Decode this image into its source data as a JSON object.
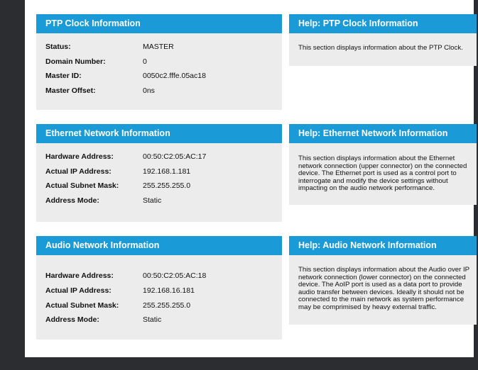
{
  "ptp": {
    "title": "PTP Clock Information",
    "rows": [
      {
        "label": "Status:",
        "value": "MASTER"
      },
      {
        "label": "Domain Number:",
        "value": "0"
      },
      {
        "label": "Master ID:",
        "value": "0050c2.fffe.05ac18"
      },
      {
        "label": "Master Offset:",
        "value": "0ns"
      }
    ],
    "help_title": "Help: PTP Clock Information",
    "help_text": "This section displays information about the PTP Clock."
  },
  "ethernet": {
    "title": "Ethernet Network Information",
    "rows": [
      {
        "label": "Hardware Address:",
        "value": "00:50:C2:05:AC:17"
      },
      {
        "label": "Actual IP Address:",
        "value": "192.168.1.181"
      },
      {
        "label": "Actual Subnet Mask:",
        "value": "255.255.255.0"
      },
      {
        "label": "Address Mode:",
        "value": "Static"
      }
    ],
    "help_title": "Help: Ethernet Network Information",
    "help_text": "This section displays information about the Ethernet network connection (upper connector) on the connected device. The Ethernet port is used as a control port to interrogate and modify the device settings without impacting on the audio network performance."
  },
  "audio": {
    "title": "Audio Network Information",
    "rows": [
      {
        "label": "Hardware Address:",
        "value": "00:50:C2:05:AC:18"
      },
      {
        "label": "Actual IP Address:",
        "value": "192.168.16.181"
      },
      {
        "label": "Actual Subnet Mask:",
        "value": "255.255.255.0"
      },
      {
        "label": "Address Mode:",
        "value": "Static"
      }
    ],
    "help_title": "Help: Audio Network Information",
    "help_text": "This section displays information about the Audio over IP network connection (lower connector) on the connected device. The AoIP port is used as a data port to provide audio transfer between devices. Ideally it should not be connected to the main network as system performance may be comprimised by heavy external traffic."
  }
}
